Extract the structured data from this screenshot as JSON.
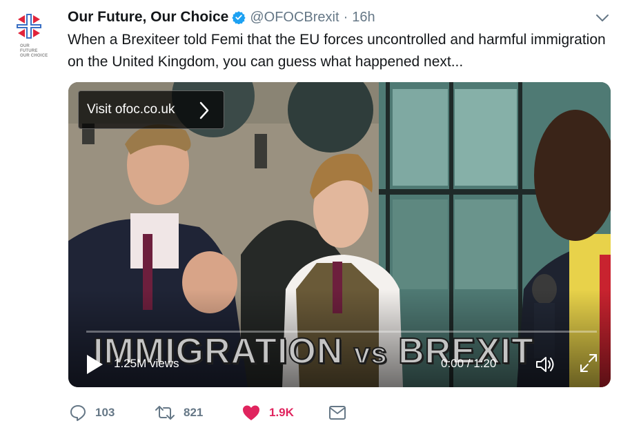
{
  "tweet": {
    "display_name": "Our Future, Our Choice",
    "handle": "@OFOCBrexit",
    "separator": "·",
    "time": "16h",
    "text": "When a Brexiteer told Femi that the EU forces uncontrolled and harmful immigration on the United Kingdom, you can guess what happened next...",
    "avatar_text_line1": "OUR FUTURE",
    "avatar_text_line2": "OUR CHOICE"
  },
  "media": {
    "visit_link": "Visit ofoc.co.uk",
    "caption_word1": "IMMIGRATION",
    "caption_vs": "vs",
    "caption_word2": "BREXIT",
    "views": "1.25M views",
    "duration": "0:00 / 1:20"
  },
  "actions": {
    "replies": "103",
    "retweets": "821",
    "likes": "1.9K"
  },
  "colors": {
    "verified": "#1da1f2",
    "like": "#e0245e",
    "muted": "#657786",
    "logo_red": "#e1243b",
    "logo_blue": "#3a6fc4"
  },
  "icons": [
    "verified-icon",
    "chevron-down-icon",
    "chevron-right-icon",
    "play-icon",
    "volume-icon",
    "fullscreen-icon",
    "reply-icon",
    "retweet-icon",
    "heart-icon",
    "envelope-icon"
  ]
}
